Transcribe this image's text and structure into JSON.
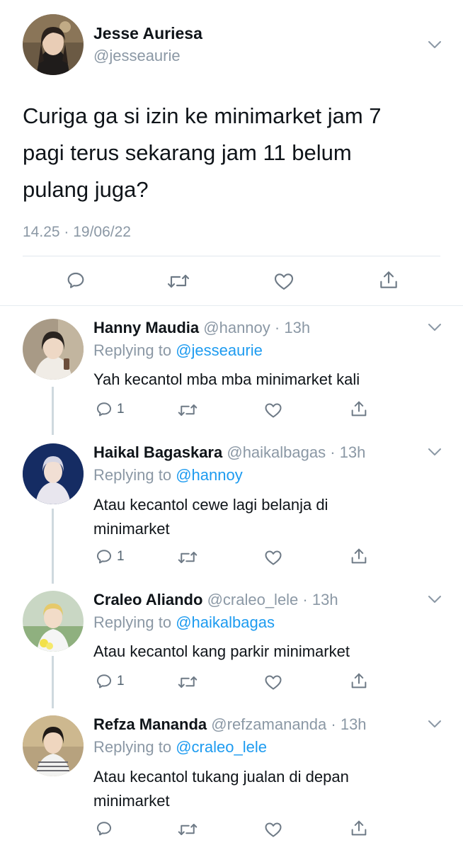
{
  "main_tweet": {
    "name": "Jesse Auriesa",
    "handle": "@jesseaurie",
    "text_lines": [
      "Curiga ga si izin ke minimarket jam 7",
      "pagi terus sekarang jam 11 belum",
      "pulang juga?"
    ],
    "timestamp": "14.25 · 19/06/22"
  },
  "replies": [
    {
      "name": "Hanny Maudia",
      "handle": "@hannoy",
      "time": "· 13h",
      "replying_prefix": "Replying to",
      "replying_to": "@jesseaurie",
      "text_lines": [
        "Yah kecantol mba mba minimarket kali"
      ],
      "reply_count": "1"
    },
    {
      "name": "Haikal Bagaskara",
      "handle": "@haikalbagas",
      "time": "· 13h",
      "replying_prefix": "Replying to",
      "replying_to": "@hannoy",
      "text_lines": [
        "Atau kecantol cewe lagi belanja di",
        "minimarket"
      ],
      "reply_count": "1"
    },
    {
      "name": "Craleo Aliando",
      "handle": "@craleo_lele",
      "time": "· 13h",
      "replying_prefix": "Replying to",
      "replying_to": "@haikalbagas",
      "text_lines": [
        "Atau kecantol kang parkir minimarket"
      ],
      "reply_count": "1"
    },
    {
      "name": "Refza Mananda",
      "handle": "@refzamananda",
      "time": "· 13h",
      "replying_prefix": "Replying to",
      "replying_to": "@craleo_lele",
      "text_lines": [
        "Atau kecantol tukang jualan di depan",
        "minimarket"
      ],
      "reply_count": ""
    }
  ],
  "icons": {
    "reply": "speech-bubble-icon",
    "retweet": "retweet-arrows-icon",
    "like": "heart-icon",
    "share": "share-upload-icon",
    "more": "chevron-down-icon"
  },
  "colors": {
    "text": "#0f1419",
    "muted": "#8b98a5",
    "link": "#1d9bf0",
    "thread_line": "#cfd9de",
    "icon": "#6e7a86"
  }
}
